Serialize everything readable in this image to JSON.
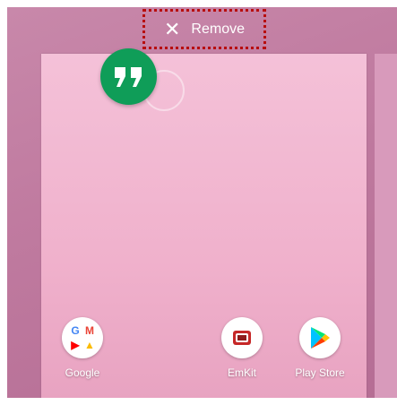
{
  "remove_bar": {
    "icon": "close-icon",
    "label": "Remove"
  },
  "dragged_app": {
    "icon": "hangouts-icon"
  },
  "dock": [
    {
      "label": "Google",
      "icon": "google-folder-icon"
    },
    {
      "label": "EmKit",
      "icon": "emkit-icon"
    },
    {
      "label": "Play Store",
      "icon": "play-store-icon"
    }
  ],
  "colors": {
    "remove_highlight": "#b80e0e",
    "hangouts_green": "#0f9d58",
    "wallpaper": "#c07ba0",
    "page_card": "#f4c1d8"
  }
}
